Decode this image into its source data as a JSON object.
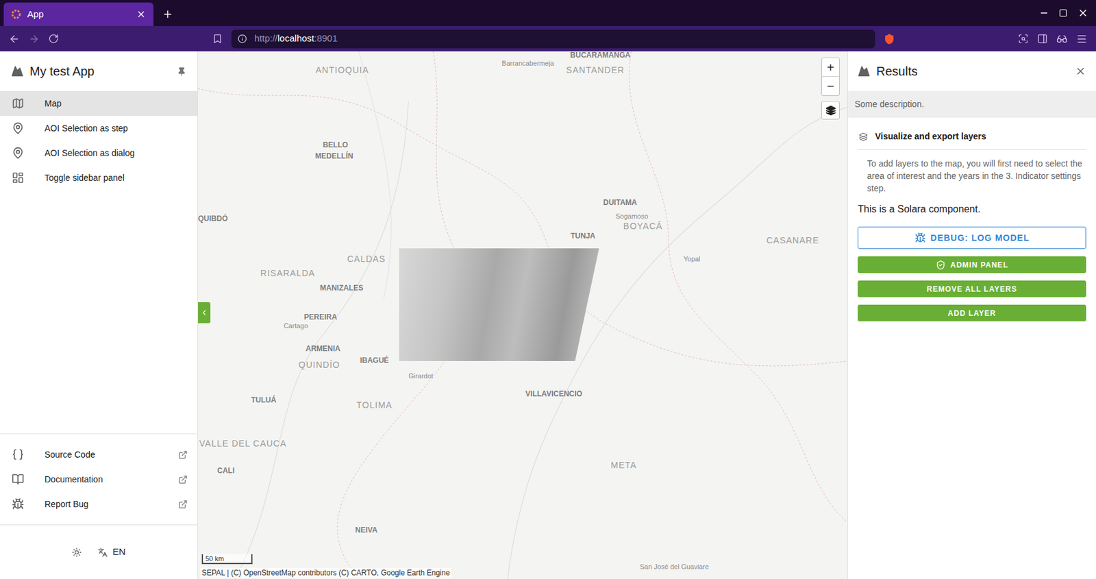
{
  "window": {
    "title": "App"
  },
  "address_bar": {
    "scheme": "http://",
    "host": "localhost",
    "port": ":8901"
  },
  "sidebar": {
    "title": "My test App",
    "items": [
      {
        "label": "Map",
        "selected": true
      },
      {
        "label": "AOI Selection as step",
        "selected": false
      },
      {
        "label": "AOI Selection as dialog",
        "selected": false
      },
      {
        "label": "Toggle sidebar panel",
        "selected": false
      }
    ],
    "links": [
      {
        "label": "Source Code"
      },
      {
        "label": "Documentation"
      },
      {
        "label": "Report Bug"
      }
    ],
    "language": "EN"
  },
  "map": {
    "zoom_in": "+",
    "zoom_out": "−",
    "scale": "50 km",
    "attribution": "SEPAL | (C) OpenStreetMap contributors (C) CARTO, Google Earth Engine",
    "labels": [
      {
        "text": "ANTIOQUIA",
        "kind": "region"
      },
      {
        "text": "Barrancabermeja",
        "kind": "town"
      },
      {
        "text": "BUCARAMANGA",
        "kind": "city"
      },
      {
        "text": "SANTANDER",
        "kind": "region"
      },
      {
        "text": "BELLO",
        "kind": "city"
      },
      {
        "text": "MEDELLÍN",
        "kind": "city"
      },
      {
        "text": "QUIBDÓ",
        "kind": "city"
      },
      {
        "text": "DUITAMA",
        "kind": "city"
      },
      {
        "text": "Sogamoso",
        "kind": "town"
      },
      {
        "text": "BOYACÁ",
        "kind": "region"
      },
      {
        "text": "TUNJA",
        "kind": "city"
      },
      {
        "text": "CASANARE",
        "kind": "region"
      },
      {
        "text": "CALDAS",
        "kind": "region"
      },
      {
        "text": "RISARALDA",
        "kind": "region"
      },
      {
        "text": "MANIZALES",
        "kind": "city"
      },
      {
        "text": "Yopal",
        "kind": "town"
      },
      {
        "text": "PEREIRA",
        "kind": "city"
      },
      {
        "text": "Cartago",
        "kind": "town"
      },
      {
        "text": "ARMENIA",
        "kind": "city"
      },
      {
        "text": "QUINDÍO",
        "kind": "region"
      },
      {
        "text": "IBAGUÉ",
        "kind": "city"
      },
      {
        "text": "Girardot",
        "kind": "town"
      },
      {
        "text": "VILLAVICENCIO",
        "kind": "city"
      },
      {
        "text": "TOLIMA",
        "kind": "region"
      },
      {
        "text": "TULUÁ",
        "kind": "city"
      },
      {
        "text": "VALLE DEL CAUCA",
        "kind": "region"
      },
      {
        "text": "CALI",
        "kind": "city"
      },
      {
        "text": "META",
        "kind": "region"
      },
      {
        "text": "NEIVA",
        "kind": "city"
      },
      {
        "text": "San José del Guaviare",
        "kind": "town"
      }
    ]
  },
  "panel": {
    "title": "Results",
    "description": "Some description.",
    "section": "Visualize and export layers",
    "note": "To add layers to the map, you will first need to select the area of interest and the years in the 3. Indicator settings step.",
    "component_text": "This is a Solara component.",
    "buttons": [
      {
        "label": "DEBUG: LOG MODEL",
        "kind": "outlined"
      },
      {
        "label": "ADMIN PANEL",
        "kind": "filled"
      },
      {
        "label": "REMOVE ALL LAYERS",
        "kind": "filled"
      },
      {
        "label": "ADD LAYER",
        "kind": "filled"
      }
    ]
  }
}
